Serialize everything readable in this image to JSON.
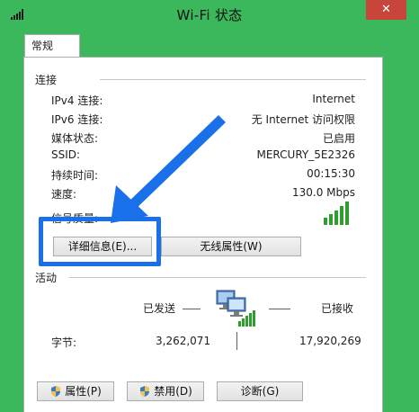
{
  "window": {
    "title": "Wi-Fi 状态",
    "close_label": "✕"
  },
  "tabs": [
    {
      "label": "常规"
    }
  ],
  "connection": {
    "group_title": "连接",
    "rows": [
      {
        "label": "IPv4 连接:",
        "value": "Internet"
      },
      {
        "label": "IPv6 连接:",
        "value": "无 Internet 访问权限"
      },
      {
        "label": "媒体状态:",
        "value": "已启用"
      },
      {
        "label": "SSID:",
        "value": "MERCURY_5E2326"
      },
      {
        "label": "持续时间:",
        "value": "00:15:30"
      },
      {
        "label": "速度:",
        "value": "130.0 Mbps"
      }
    ],
    "signal_label": "信号质量:",
    "signal_icon": "signal-bars-icon"
  },
  "buttons": {
    "details": "详细信息(E)...",
    "wireless_properties": "无线属性(W)"
  },
  "activity": {
    "group_title": "活动",
    "sent_label": "已发送",
    "received_label": "已接收",
    "bytes_label": "字节:",
    "bytes_sent": "3,262,071",
    "bytes_received": "17,920,269",
    "icon": "network-computers-icon"
  },
  "bottom_buttons": {
    "properties": "属性(P)",
    "disable": "禁用(D)",
    "diagnose": "诊断(G)"
  },
  "colors": {
    "background": "#3bb85b",
    "close": "#c7453a",
    "highlight": "#1a70e8"
  }
}
